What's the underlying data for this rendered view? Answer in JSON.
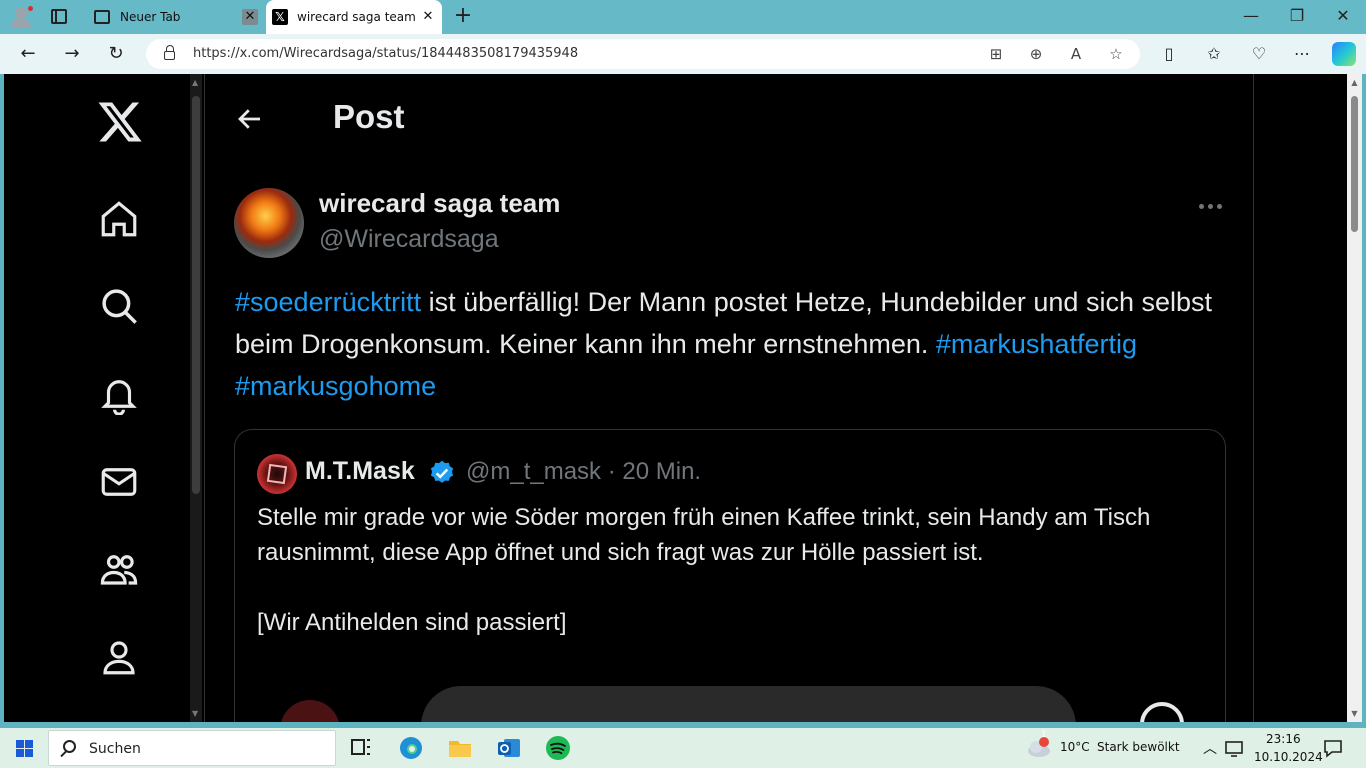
{
  "browser": {
    "tabs": [
      {
        "title": "Neuer Tab",
        "active": false
      },
      {
        "title": "wirecard saga team auf X",
        "active": true
      }
    ],
    "tab_close": "✕",
    "new_tab": "+",
    "window_buttons": {
      "minimize": "—",
      "maximize": "❐",
      "close": "✕"
    },
    "url": "https://x.com/Wirecardsaga/status/1844483508179435948",
    "x_favicon": "𝕏"
  },
  "sidebar": {
    "logo": "x-logo",
    "items": [
      "home-icon",
      "search-icon",
      "notifications-icon",
      "messages-icon",
      "communities-icon",
      "profile-icon"
    ]
  },
  "post": {
    "header_title": "Post",
    "author_name": "wirecard saga team",
    "author_handle": "@Wirecardsaga",
    "text_parts": {
      "tag1": "#soederrücktritt",
      "body": " ist überfällig! Der Mann postet Hetze, Hundebilder und sich selbst beim Drogenkonsum. Keiner kann ihn mehr ernstnehmen. ",
      "tag2": "#markushatfertig",
      "space": " ",
      "tag3": "#markusgohome"
    },
    "quote": {
      "name": "M.T.Mask",
      "handle_time": "@m_t_mask · 20 Min.",
      "text": "Stelle mir grade vor wie Söder morgen früh einen Kaffee trinkt, sein Handy am Tisch rausnimmt, diese App öffnet und sich fragt was zur Hölle passiert ist.\n\n[Wir Antihelden sind passiert]"
    }
  },
  "colors": {
    "accent": "#1d9bf0",
    "background": "#000000",
    "text": "#e7e9ea",
    "muted": "#71767b"
  },
  "taskbar": {
    "search_label": "Suchen",
    "weather_temp": "10°C",
    "weather_desc": "Stark bewölkt",
    "weather_badge": "1",
    "time": "23:16",
    "date": "10.10.2024"
  }
}
